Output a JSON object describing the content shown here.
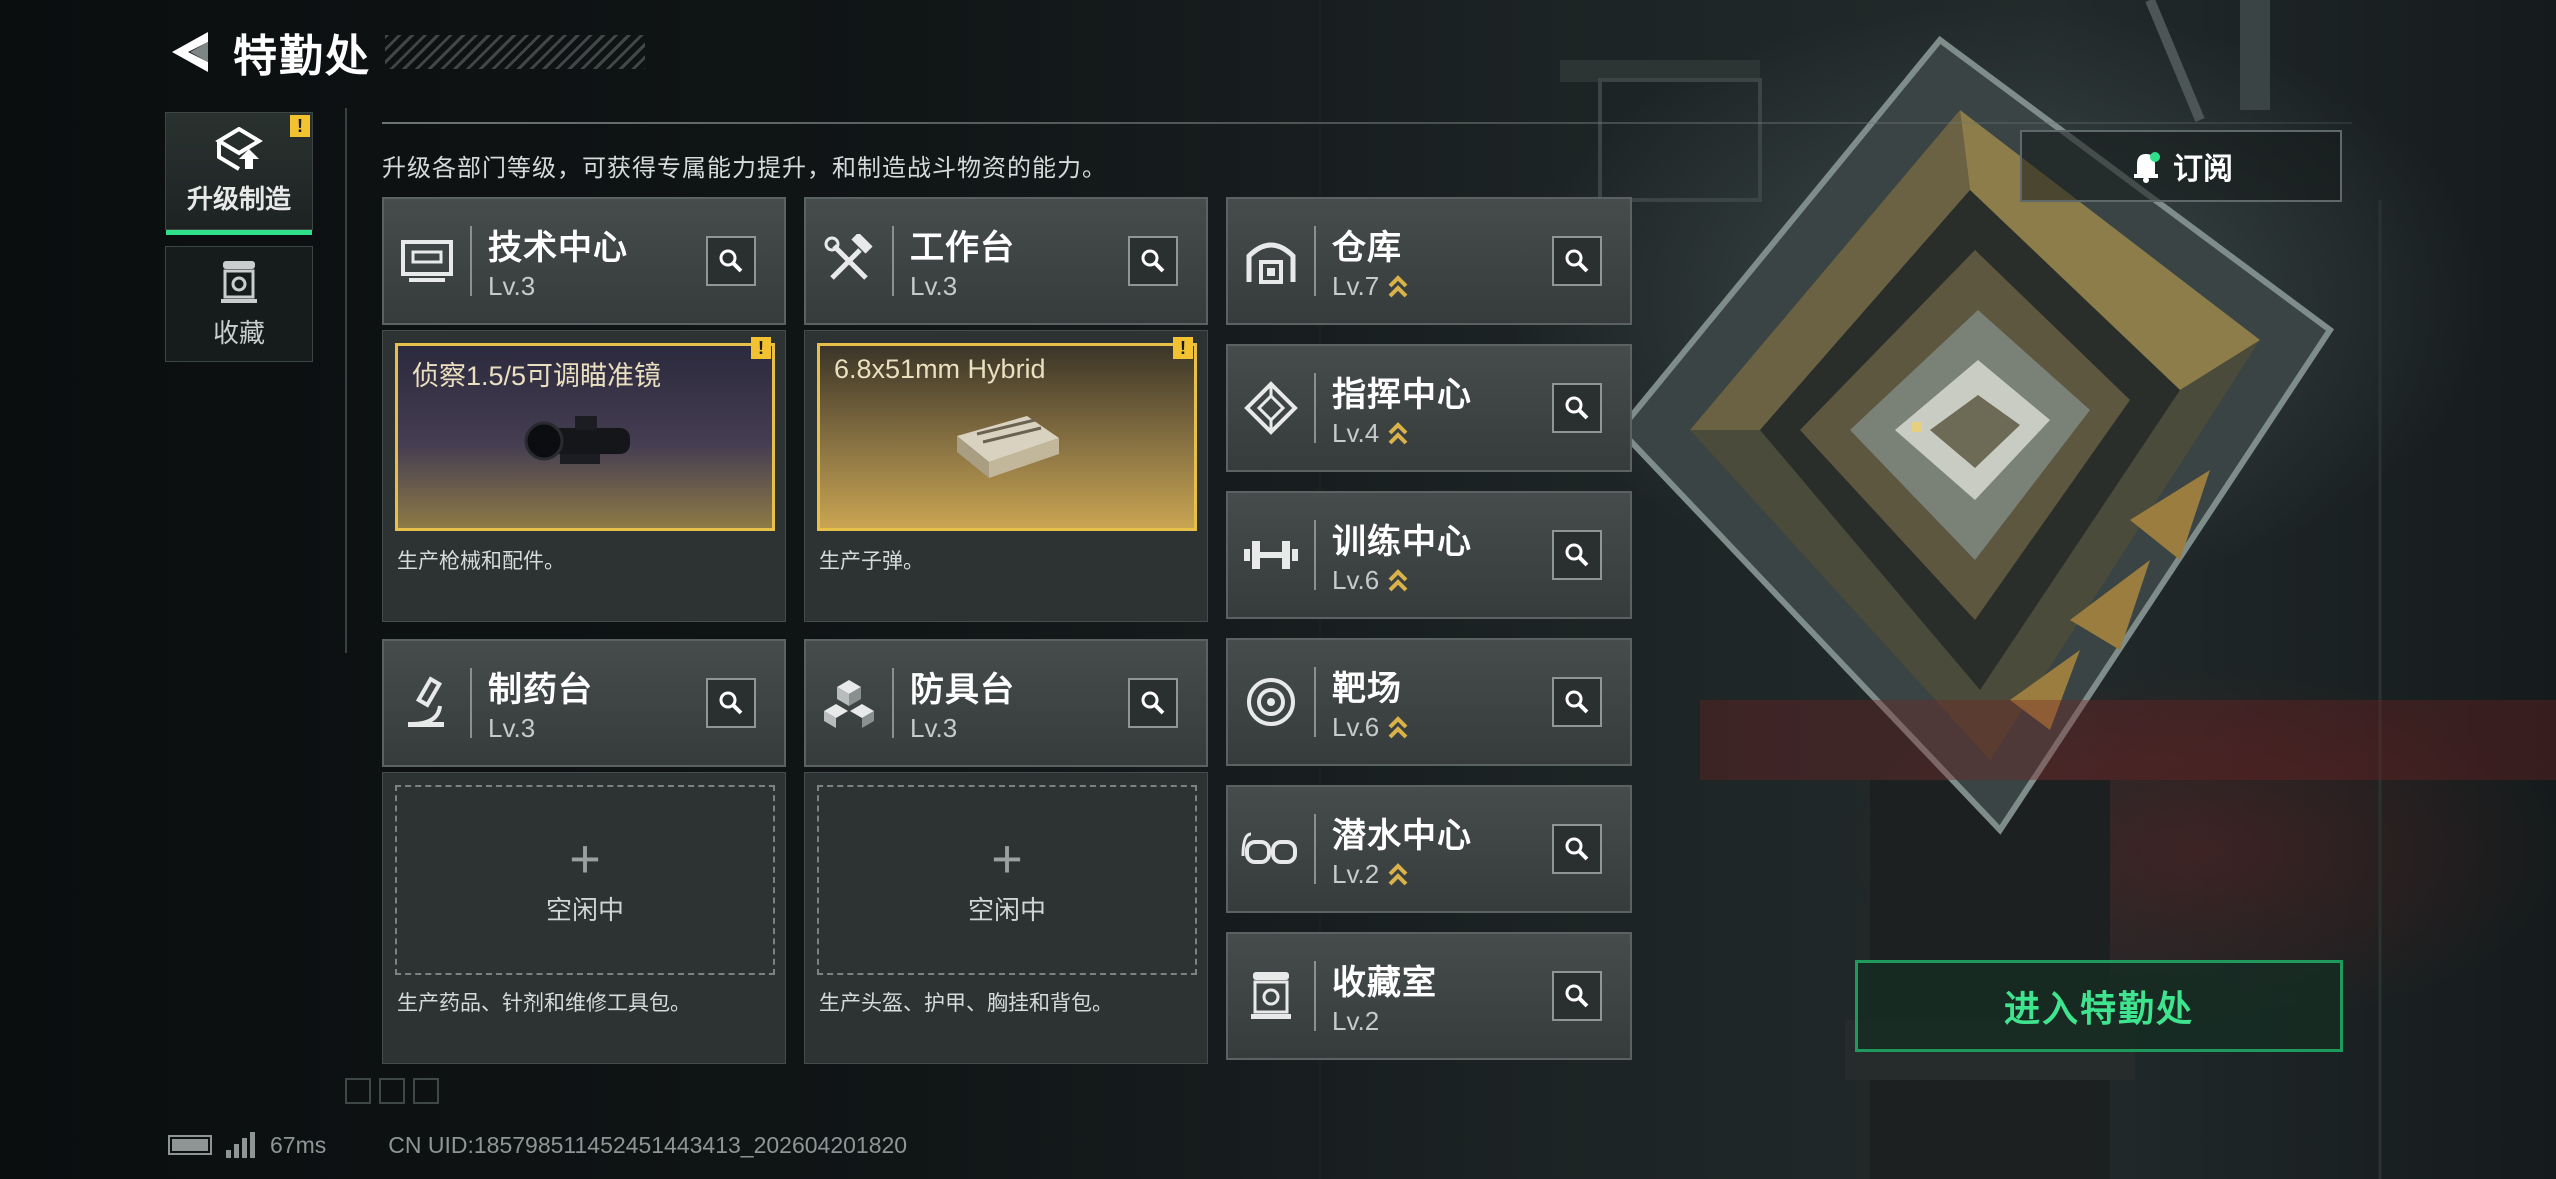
{
  "header": {
    "title": "特勤处"
  },
  "nav": {
    "upgrade_label": "升级制造",
    "collect_label": "收藏",
    "alert_mark": "!"
  },
  "subtitle": "升级各部门等级，可获得专属能力提升，和制造战斗物资的能力。",
  "production": [
    {
      "name": "技术中心",
      "level": "Lv.3",
      "icon": "monitor-icon",
      "item": "侦察1.5/5可调瞄准镜",
      "desc": "生产枪械和配件。",
      "state": "busy"
    },
    {
      "name": "工作台",
      "level": "Lv.3",
      "icon": "tools-icon",
      "item": "6.8x51mm Hybrid",
      "desc": "生产子弹。",
      "state": "busy"
    },
    {
      "name": "制药台",
      "level": "Lv.3",
      "icon": "microscope-icon",
      "idle_text": "空闲中",
      "desc": "生产药品、针剂和维修工具包。",
      "state": "idle"
    },
    {
      "name": "防具台",
      "level": "Lv.3",
      "icon": "cubes-icon",
      "idle_text": "空闲中",
      "desc": "生产头盔、护甲、胸挂和背包。",
      "state": "idle"
    }
  ],
  "departments": [
    {
      "name": "仓库",
      "level": "Lv.7",
      "icon": "warehouse-icon",
      "upgradable": true
    },
    {
      "name": "指挥中心",
      "level": "Lv.4",
      "icon": "command-icon",
      "upgradable": true
    },
    {
      "name": "训练中心",
      "level": "Lv.6",
      "icon": "dumbbell-icon",
      "upgradable": true
    },
    {
      "name": "靶场",
      "level": "Lv.6",
      "icon": "target-icon",
      "upgradable": true
    },
    {
      "name": "潜水中心",
      "level": "Lv.2",
      "icon": "goggles-icon",
      "upgradable": true
    },
    {
      "name": "收藏室",
      "level": "Lv.2",
      "icon": "trophy-icon",
      "upgradable": false
    }
  ],
  "subscribe": {
    "label": "订阅",
    "icon": "bell-icon"
  },
  "enter_button": "进入特勤处",
  "footer": {
    "ping": "67ms",
    "uid": "CN UID:185798511452451443413_202604201820"
  },
  "colors": {
    "accent_green": "#2fe08a",
    "alert_yellow": "#f2c230",
    "upgrade_gold": "#d9b24a"
  }
}
